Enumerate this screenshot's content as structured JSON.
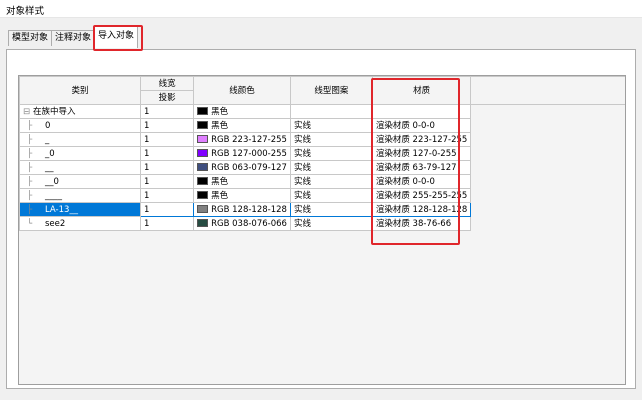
{
  "window": {
    "title": "对象样式"
  },
  "tabs": [
    {
      "label": "模型对象"
    },
    {
      "label": "注释对象"
    },
    {
      "label": "导入对象",
      "active": true
    }
  ],
  "columns": {
    "category": "类别",
    "line_weight": "线宽",
    "projection": "投影",
    "line_color": "线颜色",
    "line_pattern": "线型图案",
    "material": "材质"
  },
  "rows": [
    {
      "category": "在族中导入",
      "weight": "1",
      "color": "黑色",
      "swatch": "#000000",
      "pattern": "",
      "material": "",
      "expander": "⊟"
    },
    {
      "category": "0",
      "weight": "1",
      "color": "黑色",
      "swatch": "#000000",
      "pattern": "实线",
      "material": "渲染材质 0-0-0"
    },
    {
      "category": "_",
      "weight": "1",
      "color": "RGB 223-127-255",
      "swatch": "#df7fff",
      "pattern": "实线",
      "material": "渲染材质 223-127-255"
    },
    {
      "category": "_0",
      "weight": "1",
      "color": "RGB 127-000-255",
      "swatch": "#7f00ff",
      "pattern": "实线",
      "material": "渲染材质 127-0-255"
    },
    {
      "category": "__",
      "weight": "1",
      "color": "RGB 063-079-127",
      "swatch": "#3f4f7f",
      "pattern": "实线",
      "material": "渲染材质 63-79-127"
    },
    {
      "category": "__0",
      "weight": "1",
      "color": "黑色",
      "swatch": "#000000",
      "pattern": "实线",
      "material": "渲染材质 0-0-0"
    },
    {
      "category": "____",
      "weight": "1",
      "color": "黑色",
      "swatch": "#000000",
      "pattern": "实线",
      "material": "渲染材质 255-255-255"
    },
    {
      "category": "LA-13__",
      "weight": "1",
      "color": "RGB 128-128-128",
      "swatch": "#808080",
      "pattern": "实线",
      "material": "渲染材质 128-128-128",
      "selected": true
    },
    {
      "category": "see2",
      "weight": "1",
      "color": "RGB 038-076-066",
      "swatch": "#264c42",
      "pattern": "实线",
      "material": "渲染材质 38-76-66"
    }
  ],
  "colors": {
    "selection": "#0078d7",
    "annotation": "#e0262b"
  }
}
